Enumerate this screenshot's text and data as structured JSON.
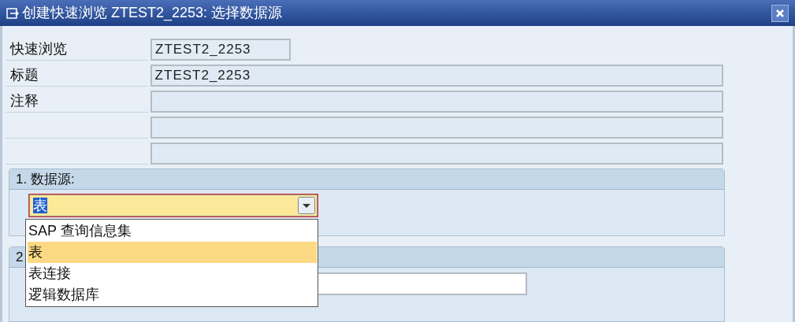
{
  "window": {
    "title": "创建快速浏览 ZTEST2_2253: 选择数据源"
  },
  "fields": [
    {
      "label": "快速浏览",
      "value": "ZTEST2_2253",
      "kind": "readonly"
    },
    {
      "label": "标题",
      "value": "ZTEST2_2253",
      "kind": "text"
    },
    {
      "label": "注释",
      "kind": "text"
    },
    {
      "kind": "text"
    },
    {
      "kind": "text"
    }
  ],
  "section_1": {
    "title": "1. 数据源:",
    "combo": {
      "value": "表",
      "options": [
        {
          "label": "SAP 查询信息集",
          "selected": false
        },
        {
          "label": "表",
          "selected": true
        },
        {
          "label": "表连接",
          "selected": false
        },
        {
          "label": "逻辑数据库",
          "selected": false
        }
      ]
    }
  },
  "section_2": {
    "title": "2"
  }
}
